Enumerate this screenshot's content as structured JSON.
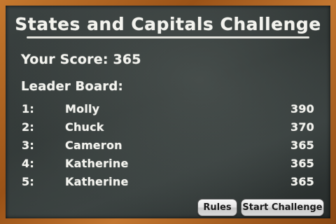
{
  "title": "States and Capitals Challenge",
  "score_text": "Your Score: 365",
  "leaderboard": {
    "heading": "Leader Board:",
    "rows": [
      {
        "rank": "1:",
        "name": "Molly",
        "score": "390"
      },
      {
        "rank": "2:",
        "name": "Chuck",
        "score": "370"
      },
      {
        "rank": "3:",
        "name": "Cameron",
        "score": "365"
      },
      {
        "rank": "4:",
        "name": "Katherine",
        "score": "365"
      },
      {
        "rank": "5:",
        "name": "Katherine",
        "score": "365"
      }
    ]
  },
  "buttons": {
    "rules": "Rules",
    "start": "Start Challenge"
  },
  "colors": {
    "chalk": "#f3f3ee",
    "board": "#2f3534",
    "frame_wood": "#b06a25"
  }
}
